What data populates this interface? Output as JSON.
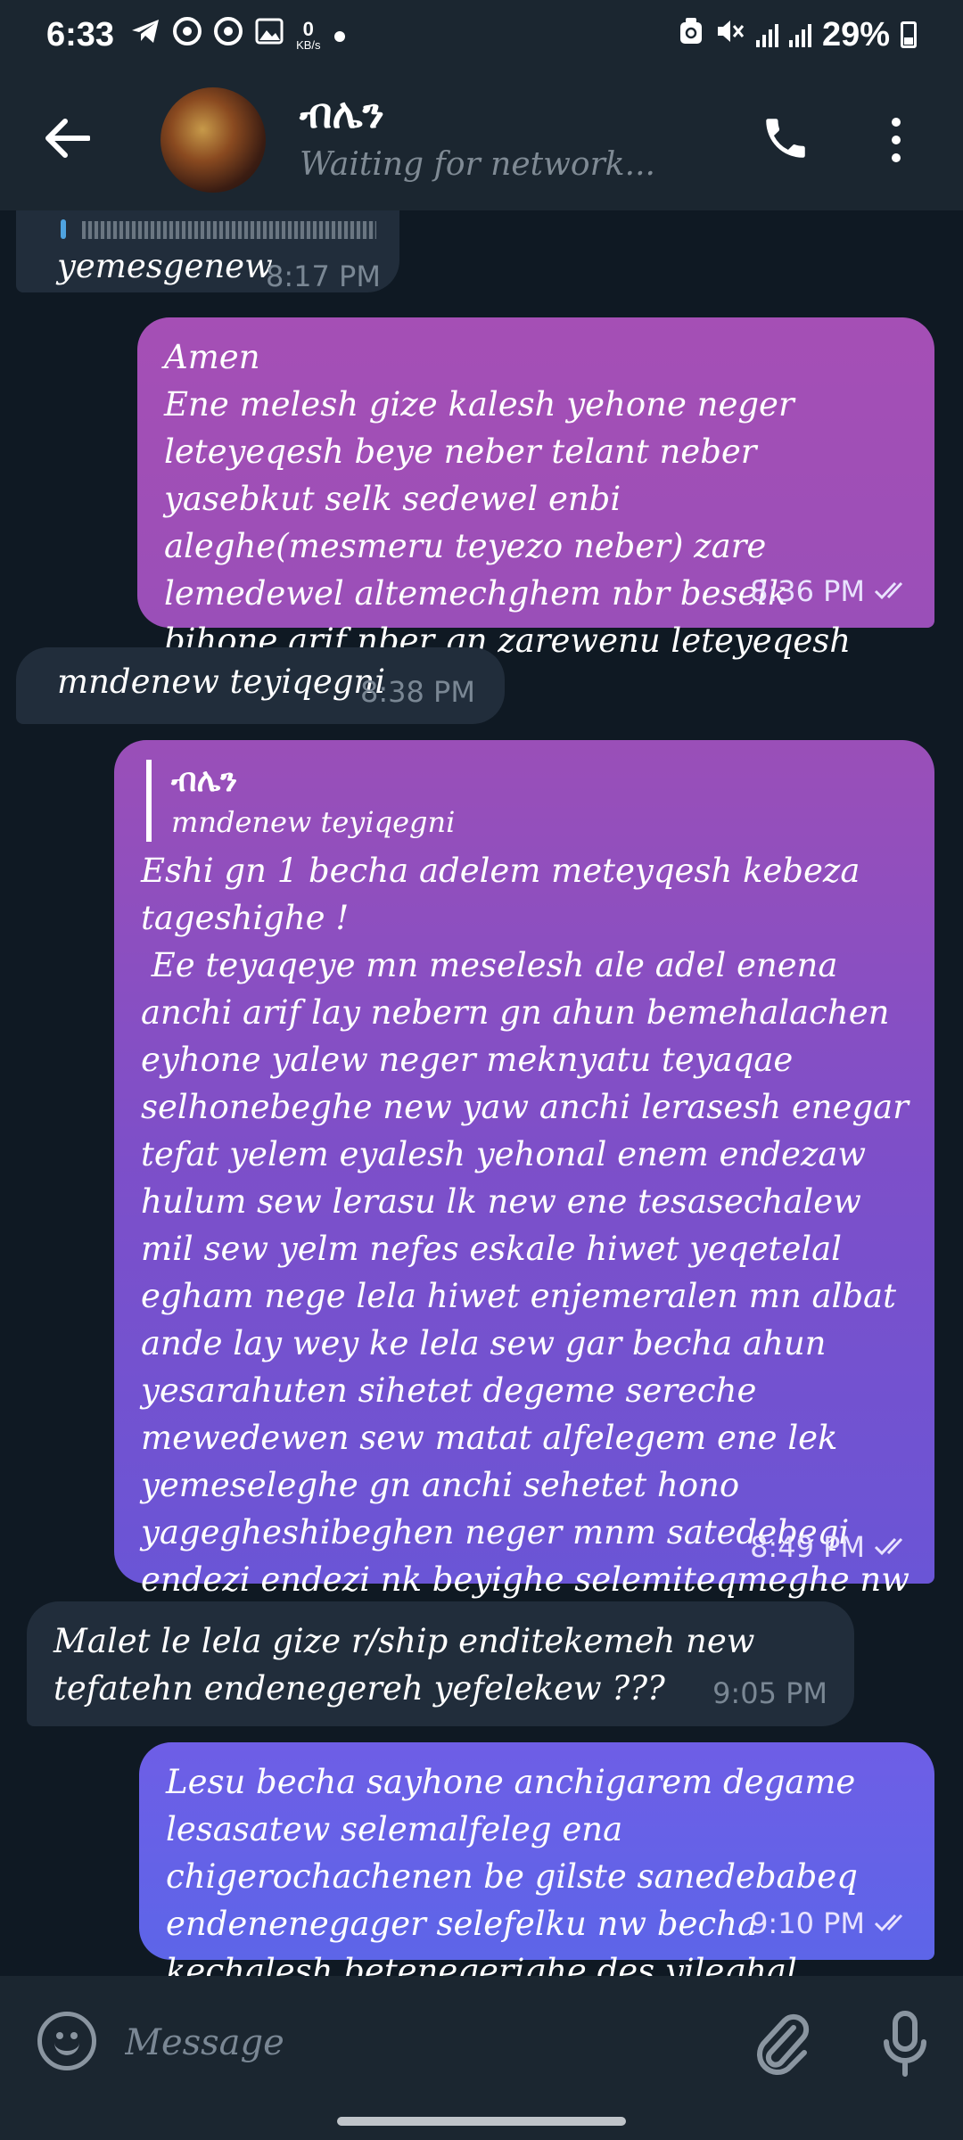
{
  "status_bar": {
    "time": "6:33",
    "net_speed_value": "0",
    "net_speed_unit": "KB/s",
    "battery": "29%"
  },
  "header": {
    "contact_name": "ብሌን",
    "status": "Waiting for network...",
    "icons": [
      "back-arrow-icon",
      "phone-icon",
      "more-vert-icon"
    ]
  },
  "messages": [
    {
      "dir": "in",
      "text": "yemesgenew",
      "time": "8:17 PM"
    },
    {
      "dir": "out",
      "text": "Amen\nEne melesh gize kalesh yehone neger leteyeqesh beye neber telant neber yasebkut selk sedewel enbi aleghe(mesmeru teyezo neber) zare lemedewel altemechghem nbr beselk bihone arif nber gn zarewenu leteyeqesh beye new",
      "time": "8:36 PM"
    },
    {
      "dir": "in",
      "text": "mndenew teyiqegni",
      "time": "8:38 PM"
    },
    {
      "dir": "out",
      "reply_name": "ብሌን",
      "reply_text": "mndenew teyiqegni",
      "text": "Eshi gn 1 becha adelem meteyqesh kebeza tageshighe !\n Ee teyaqeye mn meselesh ale adel enena anchi arif lay nebern gn ahun bemehalachen eyhone yalew neger meknyatu teyaqae selhonebeghe new yaw anchi lerasesh enegar tefat yelem eyalesh yehonal enem endezaw hulum sew lerasu lk new ene tesasechalew mil sew yelm nefes eskale hiwet yeqetelal egham nege lela hiwet enjemeralen mn albat ande lay wey ke lela sew gar becha ahun yesarahuten sihetet degeme sereche mewedewen sew matat alfelegem ene lek yemeseleghe gn anchi sehetet hono yagegheshibeghen neger mnm satedebeqi endezi endezi nk beyighe selemiteqmeghe nw",
      "time": "8:49 PM"
    },
    {
      "dir": "in",
      "text": "Malet le lela gize r/ship enditekemeh new tefatehn endenegereh yefelekew ???",
      "time": "9:05 PM"
    },
    {
      "dir": "out",
      "text": "Lesu becha sayhone anchigarem degame lesasatew selemalfeleg ena chigerochachenen be gilste sanedebabeq endenenegager selefelku nw becha kechalesh betenegerighe des yileghal",
      "time": "9:10 PM"
    }
  ],
  "input": {
    "placeholder": "Message"
  },
  "colors": {
    "background": "#0f1923",
    "bar": "#1b2630",
    "incoming_bubble": "#212d3b",
    "outgoing_top": "#a14fb5",
    "outgoing_bottom": "#5d62e8"
  }
}
